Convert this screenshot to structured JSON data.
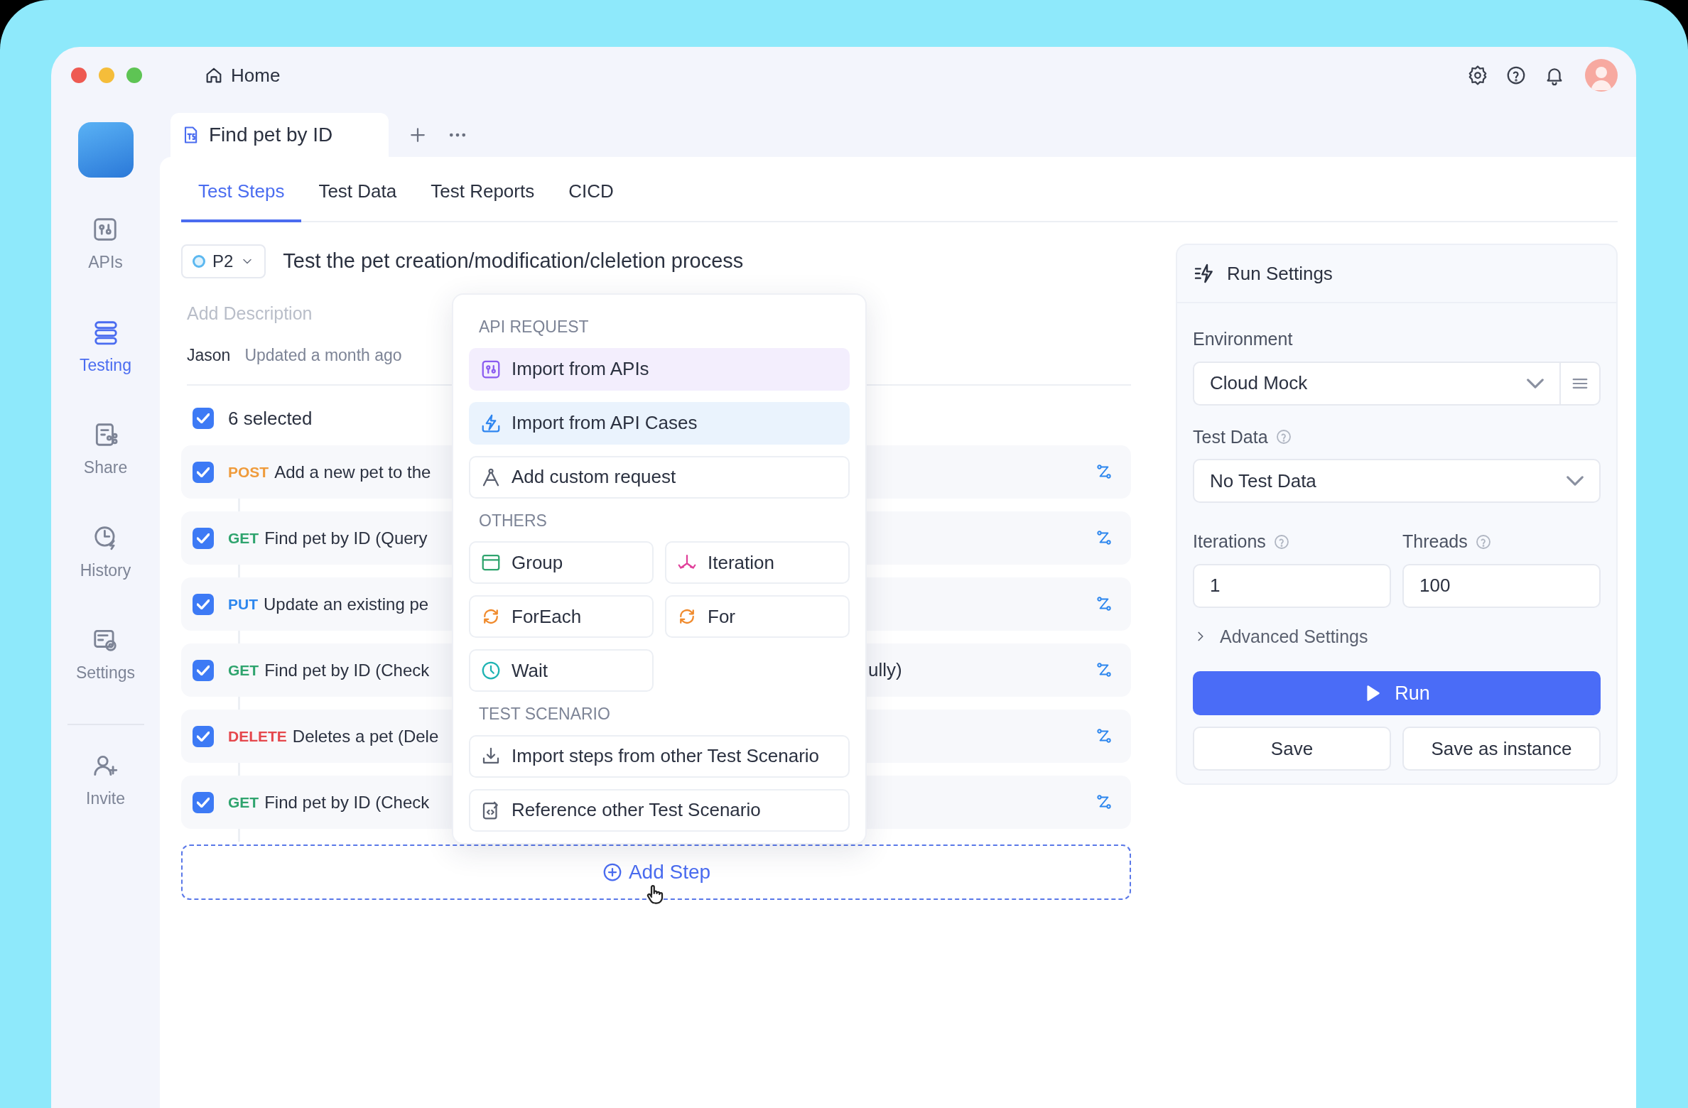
{
  "window": {
    "home": "Home"
  },
  "sidebar": {
    "items": [
      {
        "label": "APIs",
        "kind": "apis",
        "selected": false
      },
      {
        "label": "Testing",
        "kind": "testing",
        "selected": true
      },
      {
        "label": "Share",
        "kind": "share",
        "selected": false
      },
      {
        "label": "History",
        "kind": "history",
        "selected": false
      },
      {
        "label": "Settings",
        "kind": "settings",
        "selected": false
      }
    ],
    "invite": "Invite"
  },
  "doc_tab": {
    "label": "Find pet by ID"
  },
  "tabs": [
    {
      "label": "Test Steps",
      "selected": true
    },
    {
      "label": "Test Data",
      "selected": false
    },
    {
      "label": "Test Reports",
      "selected": false
    },
    {
      "label": "CICD",
      "selected": false
    }
  ],
  "scenario": {
    "priority": "P2",
    "title": "Test the pet creation/modification/cleletion process",
    "description_placeholder": "Add Description",
    "author": "Jason",
    "updated": "Updated a month ago"
  },
  "select_all": {
    "label": "6 selected",
    "checked": true
  },
  "steps": [
    {
      "method": "POST",
      "color": "#ef9b3b",
      "name": "Add a new pet to the",
      "checked": true
    },
    {
      "method": "GET",
      "color": "#2fa46e",
      "name": "Find pet by ID (Query",
      "checked": true
    },
    {
      "method": "PUT",
      "color": "#2c86ee",
      "name": "Update an existing pe",
      "checked": true
    },
    {
      "method": "GET",
      "color": "#2fa46e",
      "name": "Find pet by ID (Check",
      "tail": "ully)",
      "checked": true
    },
    {
      "method": "DELETE",
      "color": "#e5484d",
      "name": "Deletes a pet (Dele",
      "checked": true
    },
    {
      "method": "GET",
      "color": "#2fa46e",
      "name": "Find pet by ID (Check",
      "checked": true
    }
  ],
  "add_step": "Add Step",
  "menu": {
    "sections": [
      {
        "heading": "API REQUEST",
        "items": [
          {
            "label": "Import from APIs",
            "kind": "apis",
            "wide": true,
            "color": "#8a5cf0",
            "highlighted": true
          },
          {
            "label": "Import from API Cases",
            "kind": "bolt",
            "wide": true,
            "color": "#2f86f0",
            "highlighted": true
          },
          {
            "label": "Add custom request",
            "kind": "compass",
            "wide": true,
            "color": "#5b6170",
            "highlighted": false
          }
        ]
      },
      {
        "heading": "OTHERS",
        "items": [
          {
            "label": "Group",
            "kind": "group",
            "wide": false,
            "color": "#2fa46e",
            "highlighted": false
          },
          {
            "label": "Iteration",
            "kind": "iteration",
            "wide": false,
            "color": "#e0409a",
            "highlighted": false
          },
          {
            "label": "ForEach",
            "kind": "loop",
            "wide": false,
            "color": "#f08a2c",
            "highlighted": false
          },
          {
            "label": "For",
            "kind": "loop",
            "wide": false,
            "color": "#f08a2c",
            "highlighted": false
          },
          {
            "label": "Wait",
            "kind": "clock",
            "wide": false,
            "color": "#1fb3b3",
            "highlighted": false
          }
        ]
      },
      {
        "heading": "TEST SCENARIO",
        "items": [
          {
            "label": "Import steps from other Test Scenario",
            "kind": "import",
            "wide": true,
            "color": "#5b6170",
            "highlighted": false
          },
          {
            "label": "Reference other Test Scenario",
            "kind": "reference",
            "wide": true,
            "color": "#5b6170",
            "highlighted": false
          }
        ]
      }
    ]
  },
  "run_settings": {
    "title": "Run Settings",
    "environment": {
      "label": "Environment",
      "value": "Cloud Mock"
    },
    "test_data": {
      "label": "Test Data",
      "value": "No Test Data"
    },
    "iterations": {
      "label": "Iterations",
      "value": "1"
    },
    "threads": {
      "label": "Threads",
      "value": "100"
    },
    "advanced": {
      "label": "Advanced Settings",
      "expanded": false
    },
    "run": "Run",
    "save": "Save",
    "save_instance": "Save as instance"
  }
}
